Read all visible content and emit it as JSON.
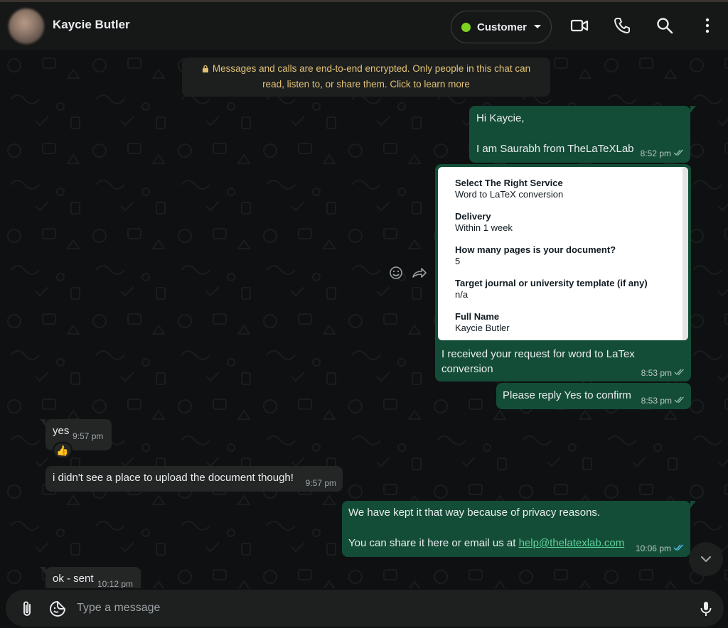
{
  "header": {
    "contact_name": "Kaycie Butler",
    "label": {
      "text": "Customer",
      "color": "#7ed321"
    }
  },
  "chat": {
    "encryption_notice": {
      "line1": "Messages and calls are end-to-end encrypted. Only people in this chat can",
      "line2": "read, listen to, or share them. Click to learn more"
    },
    "messages": [
      {
        "direction": "out",
        "line1": "Hi Kaycie,",
        "line2": "I am Saurabh from TheLaTeXLab",
        "time": "8:52 pm"
      },
      {
        "direction": "out",
        "form": [
          {
            "q": "Select The Right Service",
            "a": "Word to LaTeX conversion"
          },
          {
            "q": "Delivery",
            "a": "Within 1 week"
          },
          {
            "q": "How many pages is your document?",
            "a": "5"
          },
          {
            "q": "Target journal or university template (if any)",
            "a": "n/a"
          },
          {
            "q": "Full Name",
            "a": "Kaycie Butler"
          }
        ],
        "line1": "I received your request for word to LaTex",
        "line2": "conversion",
        "time": "8:53 pm"
      },
      {
        "direction": "out",
        "text": "Please reply Yes to confirm",
        "time": "8:53 pm"
      },
      {
        "direction": "in",
        "text": "yes",
        "time": "9:57 pm",
        "reaction": "👍"
      },
      {
        "direction": "in",
        "text": "i didn't see a place to upload the document though!",
        "time": "9:57 pm"
      },
      {
        "direction": "out",
        "line1": "We have kept it that way because of privacy reasons.",
        "line2_prefix": "You can share it here or email us at ",
        "link": "help@thelatexlab.com",
        "time": "10:06 pm"
      },
      {
        "direction": "in",
        "text": "ok - sent",
        "time": "10:12 pm"
      }
    ]
  },
  "composer": {
    "placeholder": "Type a message"
  },
  "icons": {
    "video": "video-camera-icon",
    "call": "phone-icon",
    "search": "search-icon",
    "menu": "more-vertical-icon",
    "attach": "paperclip-icon",
    "sticker": "sticker-icon",
    "mic": "microphone-icon",
    "emoji": "emoji-icon",
    "forward": "forward-icon",
    "scroll": "chevron-down-icon"
  },
  "colors": {
    "outgoing_bubble": "#144d37",
    "incoming_bubble": "#242626",
    "read_ticks": "#53bdeb",
    "notice_text": "#e2c275"
  }
}
